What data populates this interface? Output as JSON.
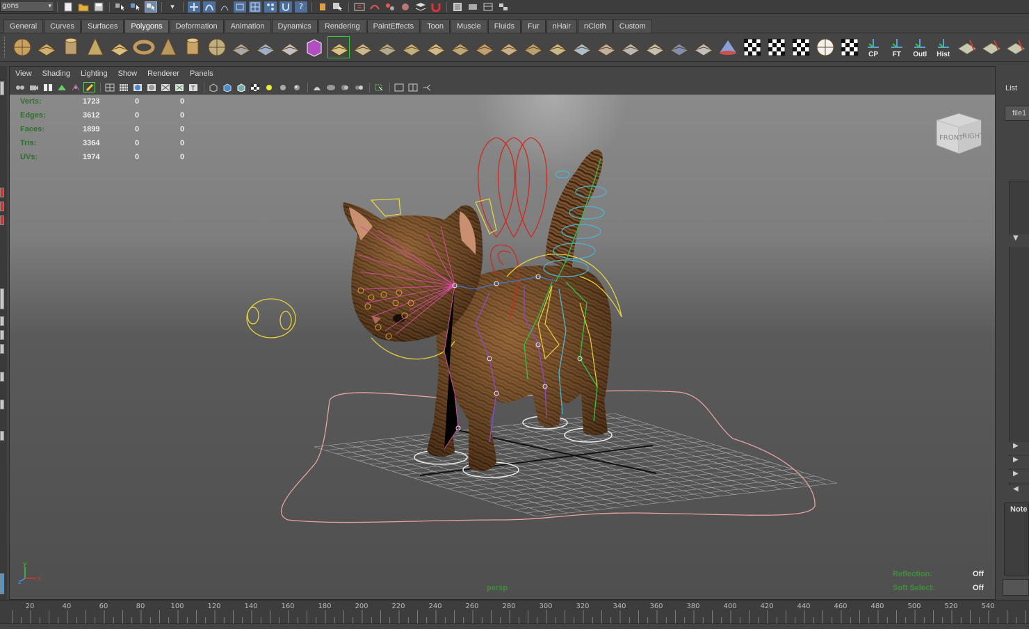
{
  "status_line": {
    "mode_menu": "gons",
    "icons": [
      "new-scene-icon",
      "open-scene-icon",
      "save-scene-icon",
      "select-by-hierarchy-icon",
      "select-by-object-icon",
      "select-by-component-icon",
      "snap-to-grid-icon",
      "snap-to-curve-icon",
      "snap-to-point-icon",
      "snap-to-view-plane-icon",
      "snap-to-live-icon",
      "help-icon",
      "construction-history-icon",
      "render-icon",
      "ipr-render-icon",
      "render-settings-icon",
      "hypershade-icon"
    ]
  },
  "shelf_tabs": [
    "General",
    "Curves",
    "Surfaces",
    "Polygons",
    "Deformation",
    "Animation",
    "Dynamics",
    "Rendering",
    "PaintEffects",
    "Toon",
    "Muscle",
    "Fluids",
    "Fur",
    "nHair",
    "nCloth",
    "Custom"
  ],
  "active_shelf_tab": "Polygons",
  "shelf": {
    "icons": [
      "poly-sphere-icon",
      "poly-cube-icon",
      "poly-cylinder-icon",
      "poly-cone-icon",
      "poly-plane-icon",
      "poly-torus-icon",
      "poly-pyramid-icon",
      "poly-pipe-icon",
      "poly-soccer-ball-icon",
      "combine-icon",
      "separate-icon",
      "smooth-icon",
      "poly-cube-purple-icon",
      "extrude-face-icon",
      "bridge-icon",
      "append-polygon-icon",
      "split-polygon-icon",
      "insert-edge-loop-icon",
      "bevel-icon",
      "merge-vertices-icon",
      "wedge-face-icon",
      "poke-face-icon",
      "mirror-icon",
      "planar-mapping-icon",
      "cylindrical-mapping-icon",
      "spherical-mapping-icon",
      "automatic-mapping-icon",
      "uv-editor-icon",
      "create-uvs-icon",
      "lighting-icon",
      "checker-1-icon",
      "checker-2-icon",
      "checker-3-icon",
      "soccer-ball-icon",
      "checker-grid-icon"
    ],
    "text_icons": [
      {
        "label": "CP",
        "name": "center-pivot"
      },
      {
        "label": "FT",
        "name": "freeze-transforms"
      },
      {
        "label": "Outl",
        "name": "outliner"
      },
      {
        "label": "Hist",
        "name": "history"
      }
    ],
    "trailing_icons": [
      "paint-weights-icon",
      "paint-skin-icon",
      "attribute-spreadsheet-icon"
    ]
  },
  "viewport": {
    "menu": [
      "View",
      "Shading",
      "Lighting",
      "Show",
      "Renderer",
      "Panels"
    ],
    "camera": "persp",
    "stats": [
      {
        "label": "Verts:",
        "v1": "1723",
        "v2": "0",
        "v3": "0"
      },
      {
        "label": "Edges:",
        "v1": "3612",
        "v2": "0",
        "v3": "0"
      },
      {
        "label": "Faces:",
        "v1": "1899",
        "v2": "0",
        "v3": "0"
      },
      {
        "label": "Tris:",
        "v1": "3364",
        "v2": "0",
        "v3": "0"
      },
      {
        "label": "UVs:",
        "v1": "1974",
        "v2": "0",
        "v3": "0"
      }
    ],
    "reflection_label": "Reflection:",
    "reflection_value": "Off",
    "soft_select_label": "Soft Select:",
    "soft_select_value": "Off",
    "viewcube_front": "FRONT",
    "viewcube_right": "RIGHT",
    "axis_x": "x",
    "axis_y": "y",
    "axis_z": "z"
  },
  "right_panel": {
    "list_label": "List",
    "file_label": "file1",
    "notes_label": "Note"
  },
  "timeline": {
    "ticks": [
      "20",
      "40",
      "60",
      "80",
      "100",
      "120",
      "140",
      "160",
      "180",
      "200",
      "220",
      "240",
      "260",
      "280",
      "300",
      "320",
      "340",
      "360",
      "380",
      "400",
      "420",
      "440",
      "460",
      "480",
      "500",
      "520",
      "540"
    ]
  },
  "colors": {
    "hud_green": "#3f8f3a",
    "cat_fur": "#6b4a2a",
    "nurbs_yellow": "#e8d33a",
    "nurbs_red": "#d02a1e",
    "nurbs_cyan": "#4ab6d6",
    "joint_magenta": "#d24aa0"
  }
}
